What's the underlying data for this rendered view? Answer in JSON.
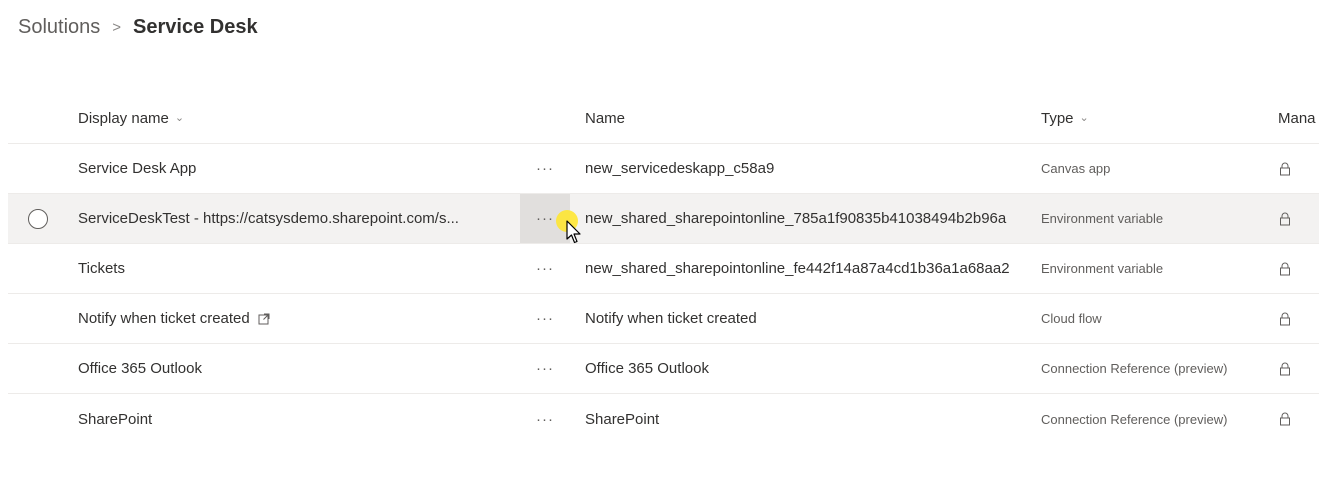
{
  "breadcrumb": {
    "root": "Solutions",
    "separator": ">",
    "current": "Service Desk"
  },
  "columns": {
    "display_name": "Display name",
    "name": "Name",
    "type": "Type",
    "managed": "Mana"
  },
  "more_label": "···",
  "rows": [
    {
      "display_name": "Service Desk App",
      "name": "new_servicedeskapp_c58a9",
      "type": "Canvas app",
      "selected": false,
      "external": false
    },
    {
      "display_name": "ServiceDeskTest - https://catsysdemo.sharepoint.com/s...",
      "name": "new_shared_sharepointonline_785a1f90835b41038494b2b96a",
      "type": "Environment variable",
      "selected": true,
      "external": false
    },
    {
      "display_name": "Tickets",
      "name": "new_shared_sharepointonline_fe442f14a87a4cd1b36a1a68aa2",
      "type": "Environment variable",
      "selected": false,
      "external": false
    },
    {
      "display_name": "Notify when ticket created",
      "name": "Notify when ticket created",
      "type": "Cloud flow",
      "selected": false,
      "external": true
    },
    {
      "display_name": "Office 365 Outlook",
      "name": "Office 365 Outlook",
      "type": "Connection Reference (preview)",
      "selected": false,
      "external": false
    },
    {
      "display_name": "SharePoint",
      "name": "SharePoint",
      "type": "Connection Reference (preview)",
      "selected": false,
      "external": false
    }
  ],
  "icons": {
    "sort": "chevron-down-icon",
    "lock": "lock-icon",
    "external": "open-external-icon",
    "select": "radio-circle-icon",
    "more": "more-options-icon",
    "cursor": "mouse-pointer-icon"
  },
  "colors": {
    "text": "#323130",
    "muted": "#605e5c",
    "row_divider": "#edebe9",
    "selected_row": "#f3f2f1",
    "cursor_highlight": "#ffe628"
  }
}
